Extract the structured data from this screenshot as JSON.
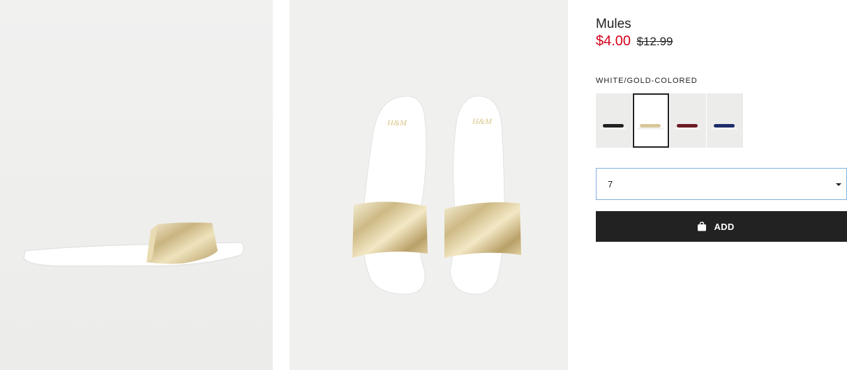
{
  "product": {
    "title": "Mules",
    "sale_price": "$4.00",
    "original_price": "$12.99",
    "color_label": "WHITE/GOLD-COLORED",
    "colors": {
      "sale_price": "#d6001c",
      "button_bg": "#222222",
      "select_border": "#7fb0df"
    }
  },
  "swatches": [
    {
      "name": "black",
      "strap": "#222222",
      "sole": "#f4f4f4"
    },
    {
      "name": "white-gold",
      "strap": "#d8c79a",
      "sole": "#ffffff",
      "selected": true
    },
    {
      "name": "burgundy",
      "strap": "#6b1a24",
      "sole": "#f4f4f4"
    },
    {
      "name": "navy",
      "strap": "#1f2d6b",
      "sole": "#f4f4f4"
    }
  ],
  "size_select": {
    "value": "7"
  },
  "add_button": {
    "label": "ADD",
    "icon": "shopping-bag-icon"
  },
  "images": [
    {
      "name": "side-view"
    },
    {
      "name": "top-view"
    }
  ]
}
